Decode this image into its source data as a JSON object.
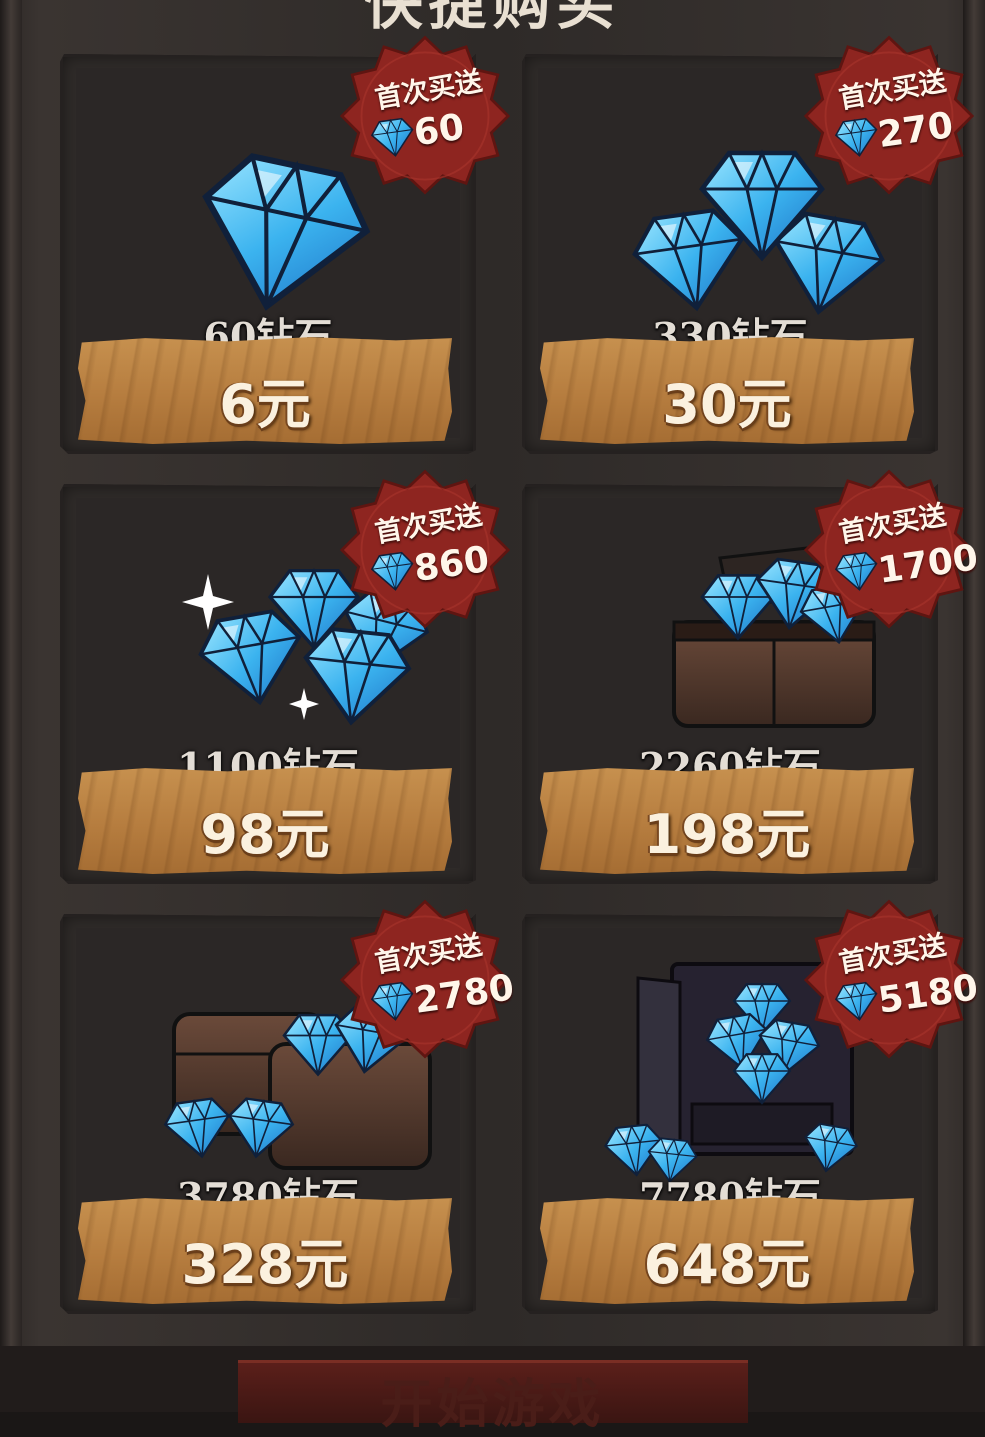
{
  "header": {
    "title": "快捷购买"
  },
  "footer": {
    "start_button_label": "开始游戏"
  },
  "colors": {
    "badge_red": "#8e2520",
    "gem_blue": "#3fb2ea",
    "price_wood": "#b67d3f"
  },
  "products": [
    {
      "label": "60钻石",
      "price": "6元",
      "bonus_label": "首次买送",
      "bonus_amount": "60",
      "art": "single-gem"
    },
    {
      "label": "330钻石",
      "price": "30元",
      "bonus_label": "首次买送",
      "bonus_amount": "270",
      "art": "gem-pile"
    },
    {
      "label": "1100钻石",
      "price": "98元",
      "bonus_label": "首次买送",
      "bonus_amount": "860",
      "art": "sparkling-gems"
    },
    {
      "label": "2260钻石",
      "price": "198元",
      "bonus_label": "首次买送",
      "bonus_amount": "1700",
      "art": "gem-chest"
    },
    {
      "label": "3780钻石",
      "price": "328元",
      "bonus_label": "首次买送",
      "bonus_amount": "2780",
      "art": "two-gem-chests"
    },
    {
      "label": "7780钻石",
      "price": "648元",
      "bonus_label": "首次买送",
      "bonus_amount": "5180",
      "art": "gem-cabinet"
    }
  ]
}
